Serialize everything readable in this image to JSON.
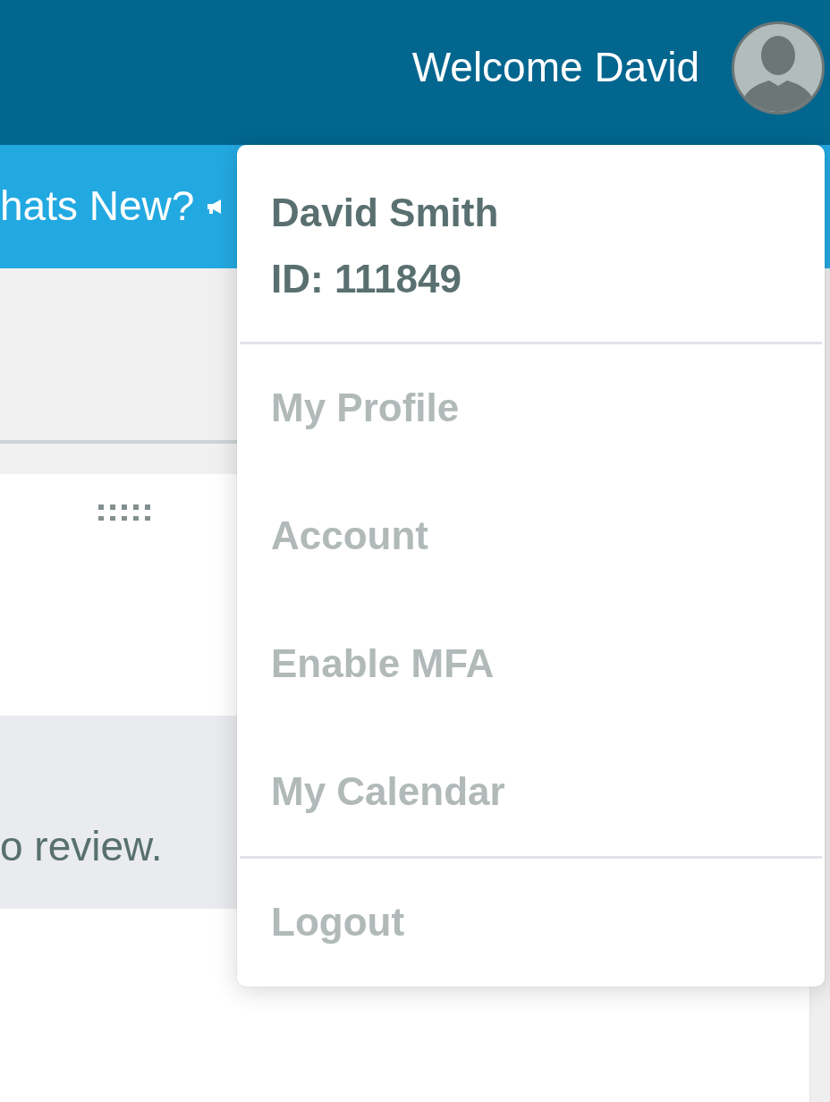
{
  "header": {
    "welcome": "Welcome David"
  },
  "subbar": {
    "link": "hats New?"
  },
  "review_banner": {
    "text": "o review."
  },
  "user_menu": {
    "open": true,
    "name": "David Smith",
    "id_label": "ID: 111849",
    "sections": [
      {
        "items": [
          {
            "label": "My Profile"
          },
          {
            "label": "Account"
          },
          {
            "label": "Enable MFA"
          },
          {
            "label": "My Calendar"
          }
        ]
      },
      {
        "items": [
          {
            "label": "Logout"
          }
        ]
      }
    ]
  }
}
